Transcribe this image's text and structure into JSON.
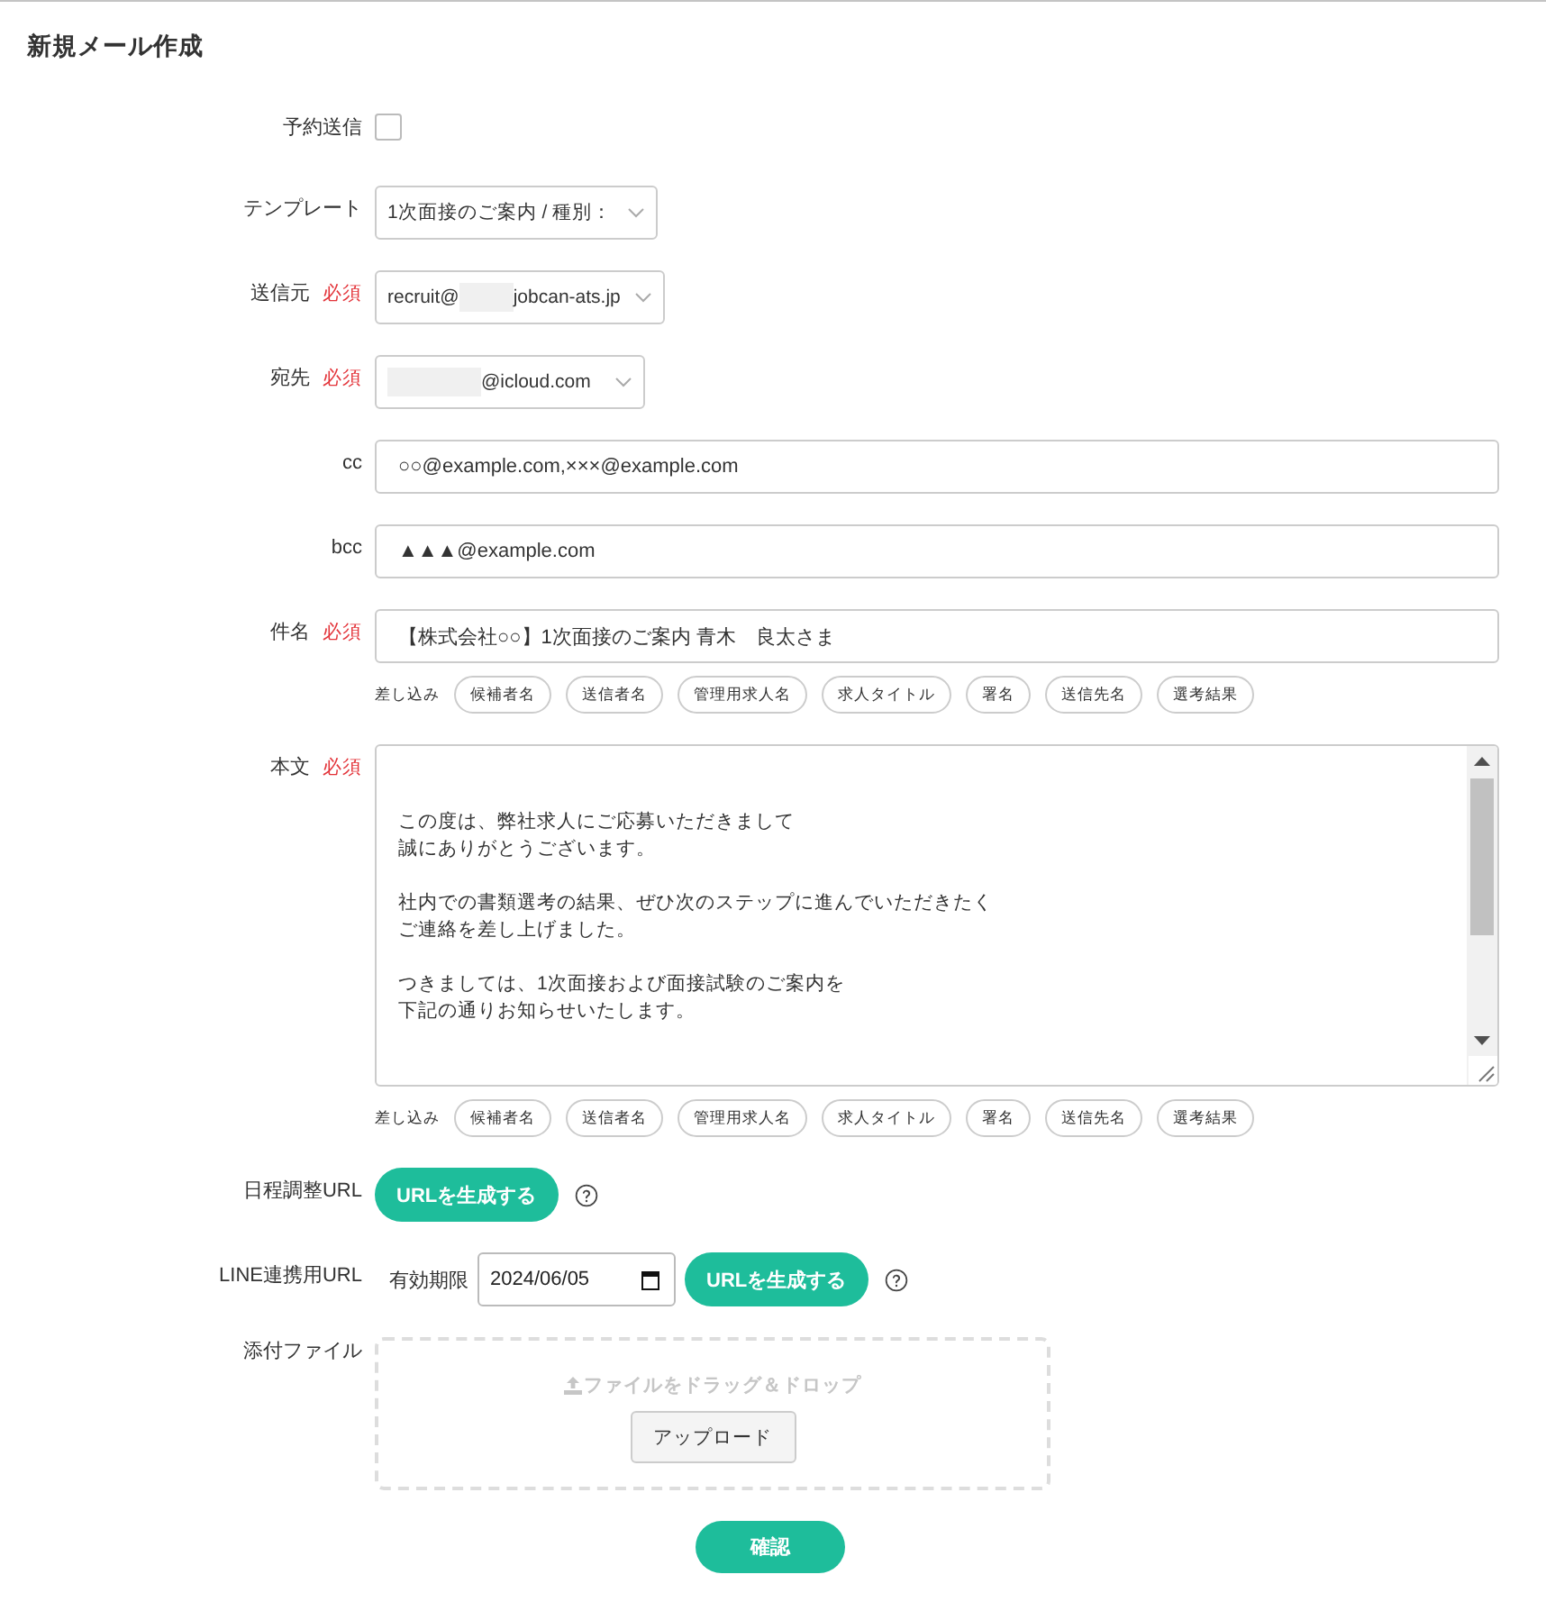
{
  "page_title": "新規メール作成",
  "fields": [
    {
      "kind": "checkbox",
      "label": "予約送信",
      "checked": false
    },
    {
      "kind": "select",
      "label": "テンプレート",
      "value": [
        {
          "kind": "text",
          "text": "1次面接のご案内 / 種別："
        }
      ]
    },
    {
      "kind": "select",
      "label": "送信元",
      "required": "必須",
      "value": [
        {
          "kind": "text",
          "text": "recruit@"
        },
        {
          "kind": "redacted"
        },
        {
          "kind": "text",
          "text": "jobcan-ats.jp"
        }
      ]
    },
    {
      "kind": "select",
      "label": "宛先",
      "required": "必須",
      "value": [
        {
          "kind": "redacted"
        },
        {
          "kind": "text",
          "text": "@icloud.com"
        }
      ]
    },
    {
      "kind": "input",
      "label": "cc",
      "value": "○○@example.com,×××@example.com"
    },
    {
      "kind": "input",
      "label": "bcc",
      "value": "▲▲▲@example.com"
    },
    {
      "kind": "input",
      "label": "件名",
      "required": "必須",
      "value": "【株式会社○○】1次面接のご案内 青木　良太さま",
      "inserts": {
        "label": "差し込み",
        "chips": [
          "候補者名",
          "送信者名",
          "管理用求人名",
          "求人タイトル",
          "署名",
          "送信先名",
          "選考結果"
        ]
      }
    },
    {
      "kind": "textarea",
      "label": "本文",
      "required": "必須",
      "paragraphs": [
        [
          "この度は、弊社求人にご応募いただきまして",
          "誠にありがとうございます。"
        ],
        [
          "社内での書類選考の結果、ぜひ次のステップに進んでいただきたく",
          "ご連絡を差し上げました。"
        ],
        [
          "つきましては、1次面接および面接試験のご案内を",
          "下記の通りお知らせいたします。"
        ]
      ],
      "inserts": {
        "label": "差し込み",
        "chips": [
          "候補者名",
          "送信者名",
          "管理用求人名",
          "求人タイトル",
          "署名",
          "送信先名",
          "選考結果"
        ]
      }
    },
    {
      "kind": "url_generator",
      "label": "日程調整URL",
      "button": "URLを生成する"
    },
    {
      "kind": "url_generator",
      "label": "LINE連携用URL",
      "expiry_label": "有効期限",
      "date": "2024/06/05",
      "button": "URLを生成する"
    },
    {
      "kind": "dropzone",
      "label": "添付ファイル",
      "hint": "ファイルをドラッグ＆ドロップ",
      "button": "アップロード"
    }
  ],
  "submit": "確認"
}
